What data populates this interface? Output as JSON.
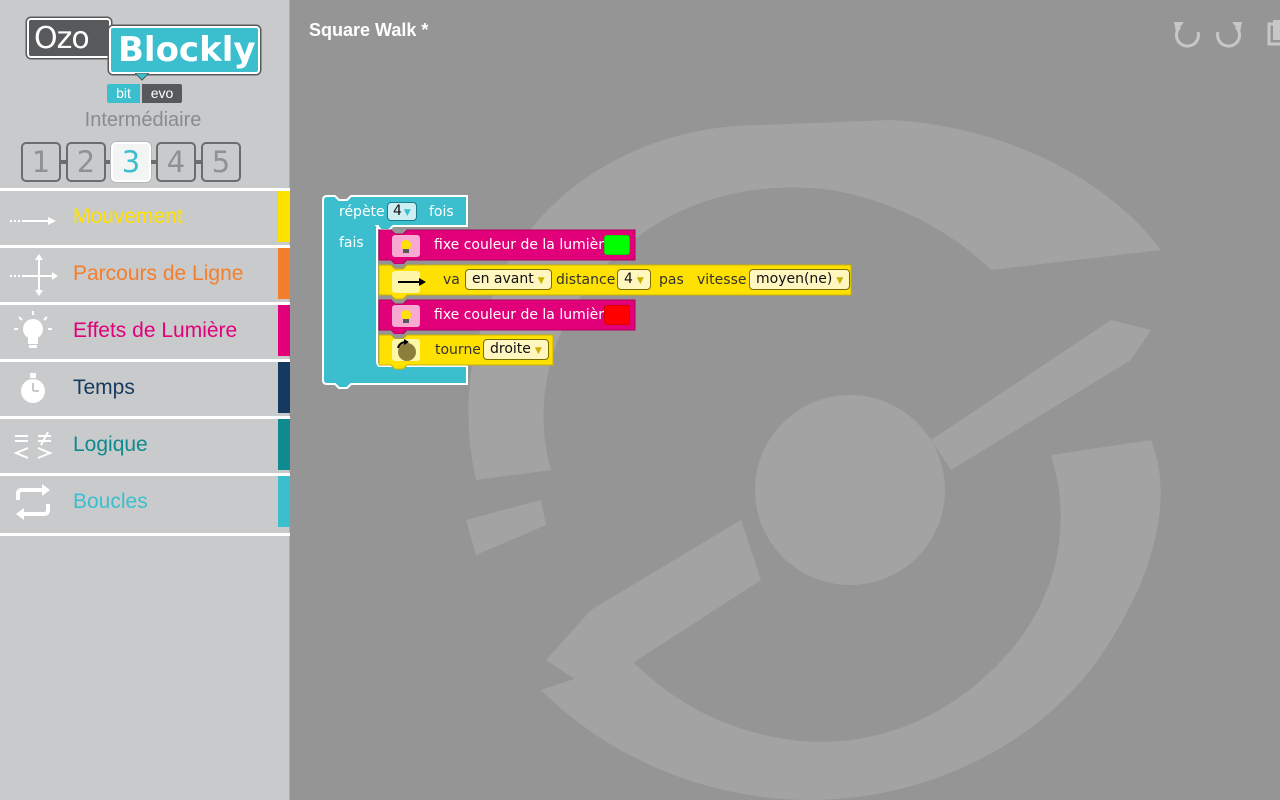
{
  "app": {
    "logo_left": "Ozo",
    "logo_right": "Blockly",
    "logo_tag_left": "bit",
    "logo_tag_right": "evo"
  },
  "level": {
    "title": "Intermédiaire",
    "options": [
      "1",
      "2",
      "3",
      "4",
      "5"
    ],
    "selected": "3"
  },
  "categories": [
    {
      "label": "Mouvement",
      "color": "#ffe100",
      "icon": "arrow-right-icon"
    },
    {
      "label": "Parcours de Ligne",
      "color": "#f37e2c",
      "icon": "line-junction-icon"
    },
    {
      "label": "Effets de Lumière",
      "color": "#e2007a",
      "icon": "lightbulb-icon"
    },
    {
      "label": "Temps",
      "color": "#163a5f",
      "icon": "stopwatch-icon"
    },
    {
      "label": "Logique",
      "color": "#0f8a8f",
      "icon": "logic-compare-icon"
    },
    {
      "label": "Boucles",
      "color": "#3bbfce",
      "icon": "loop-arrows-icon"
    }
  ],
  "workspace": {
    "project_title": "Square Walk *",
    "toolbar": {
      "undo": "undo-icon",
      "redo": "redo-icon",
      "copy": "copy-icon"
    }
  },
  "program": {
    "repeat": {
      "label_before": "répète",
      "count": "4",
      "label_after": "fois",
      "do_label": "fais"
    },
    "blocks": [
      {
        "type": "light",
        "label": "fixe couleur de la lumière",
        "color": "#00ff00"
      },
      {
        "type": "move",
        "go": "va",
        "direction": "en avant",
        "distance_label": "distance",
        "distance": "4",
        "unit": "pas",
        "speed_label": "vitesse",
        "speed": "moyen(ne)"
      },
      {
        "type": "light",
        "label": "fixe couleur de la lumière",
        "color": "#ff0000"
      },
      {
        "type": "turn",
        "label": "tourne",
        "direction": "droite"
      }
    ]
  },
  "colors": {
    "workspace_bg": "#959596",
    "sidebar_bg": "#c9cacb",
    "loop_block": "#3bbfce",
    "light_block": "#e2007a",
    "move_block": "#ffe100"
  }
}
